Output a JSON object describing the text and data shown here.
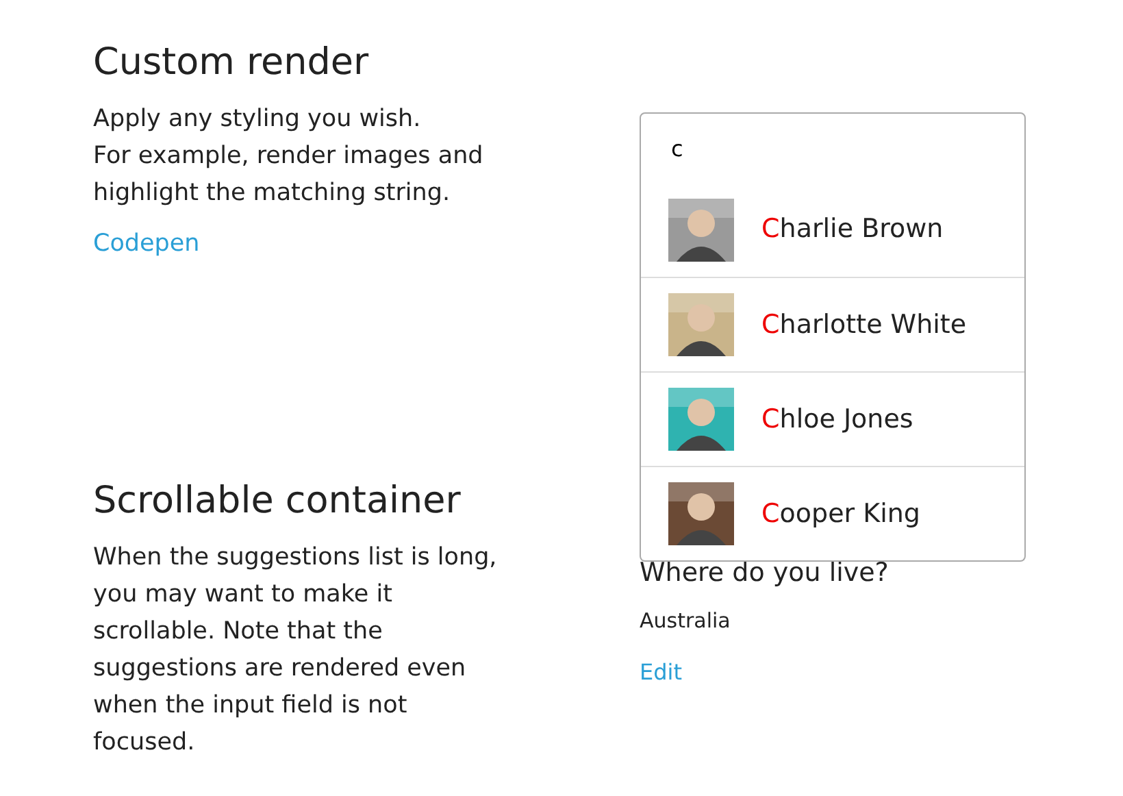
{
  "sections": [
    {
      "title": "Custom render",
      "lines": [
        "Apply any styling you wish.",
        "For example, render images and",
        "highlight the matching string."
      ],
      "link": "Codepen"
    },
    {
      "title": "Scrollable container",
      "lines": [
        "When the suggestions list is long,",
        "you may want to make it",
        "scrollable. Note that the",
        "suggestions are rendered even",
        "when the input field is not",
        "focused."
      ]
    }
  ],
  "search": {
    "value": "c"
  },
  "suggestions": [
    {
      "match": "C",
      "rest": "harlie Brown",
      "selected": false
    },
    {
      "match": "C",
      "rest": "harlotte White",
      "selected": false
    },
    {
      "match": "C",
      "rest": "hloe Jones",
      "selected": false
    },
    {
      "match": "C",
      "rest": "ooper King",
      "selected": false
    }
  ],
  "form": {
    "question": "Where do you live?",
    "answer": "Australia",
    "link": "Edit"
  }
}
